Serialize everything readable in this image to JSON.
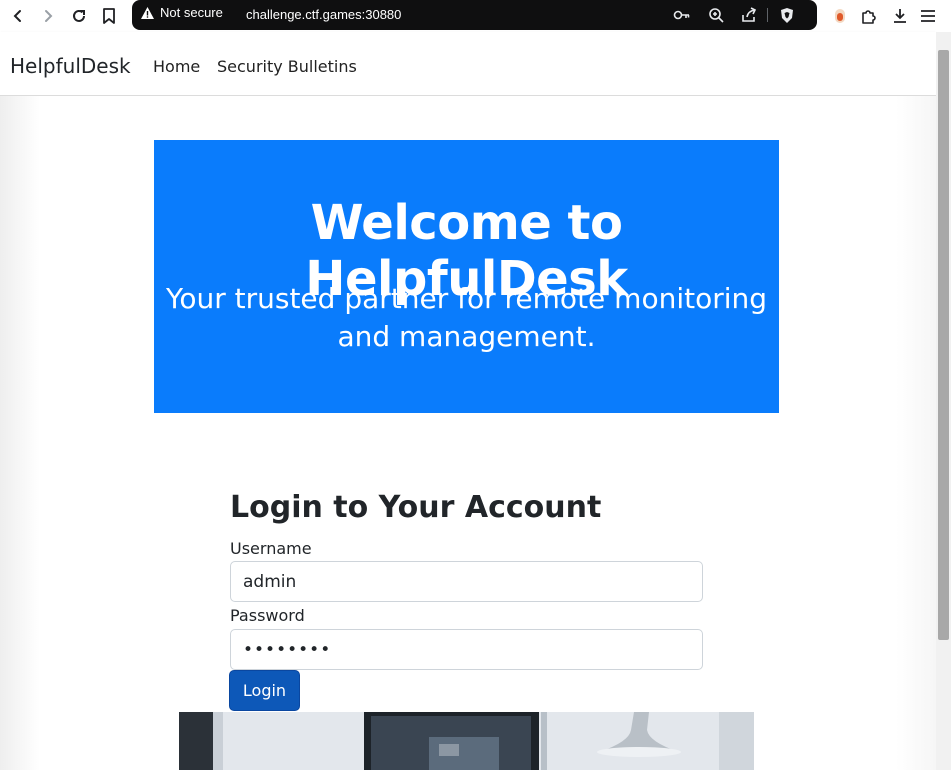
{
  "browser": {
    "not_secure": "Not secure",
    "url": "challenge.ctf.games:30880"
  },
  "navbar": {
    "brand": "HelpfulDesk",
    "links": [
      "Home",
      "Security Bulletins"
    ]
  },
  "hero": {
    "title": "Welcome to HelpfulDesk",
    "subtitle": "Your trusted partner for remote monitoring and management."
  },
  "login": {
    "heading": "Login to Your Account",
    "username_label": "Username",
    "username_value": "admin",
    "password_label": "Password",
    "password_value": "••••••••",
    "button_label": "Login"
  },
  "colors": {
    "hero_bg": "#0a7cfc",
    "button_bg": "#0d58b8"
  }
}
